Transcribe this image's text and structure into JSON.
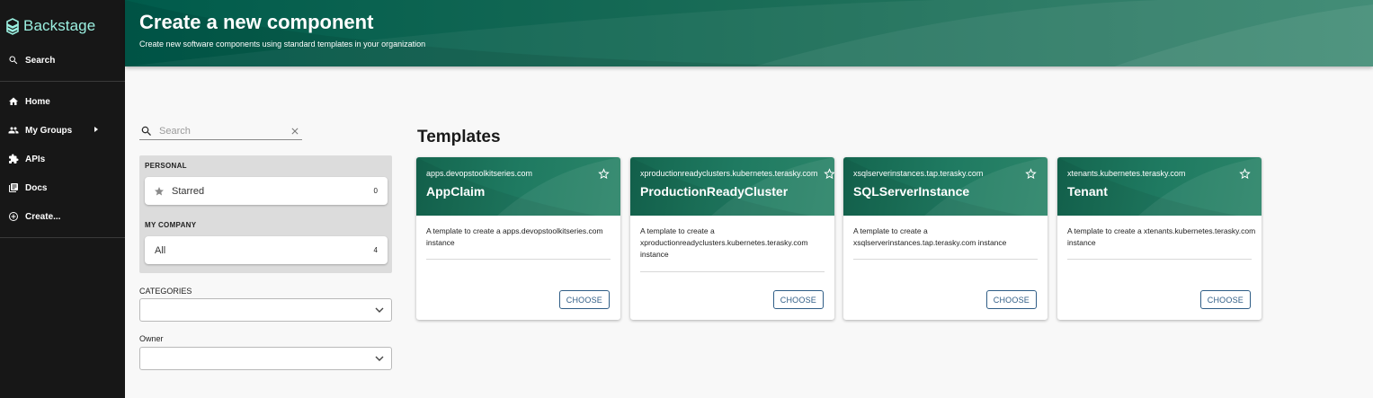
{
  "sidebar": {
    "logo_text": "Backstage",
    "search_label": "Search",
    "items": [
      {
        "label": "Home",
        "icon": "home-icon"
      },
      {
        "label": "My Groups",
        "icon": "people-icon"
      },
      {
        "label": "APIs",
        "icon": "puzzle-icon"
      },
      {
        "label": "Docs",
        "icon": "docs-icon"
      },
      {
        "label": "Create...",
        "icon": "add-circle-icon"
      }
    ]
  },
  "header": {
    "title": "Create a new component",
    "subtitle": "Create new software components using standard templates in your organization"
  },
  "filters": {
    "search_placeholder": "Search",
    "personal_heading": "PERSONAL",
    "starred_label": "Starred",
    "starred_count": "0",
    "company_heading": "MY COMPANY",
    "all_label": "All",
    "all_count": "4",
    "categories_label": "CATEGORIES",
    "categories_value": "",
    "owner_label": "Owner",
    "owner_value": ""
  },
  "templates": {
    "heading": "Templates",
    "cards": [
      {
        "type": "apps.devopstoolkitseries.com",
        "name": "AppClaim",
        "description": "A template to create a apps.devopstoolkitseries.com instance",
        "button": "CHOOSE"
      },
      {
        "type": "xproductionreadyclusters.kubernetes.terasky.com",
        "name": "ProductionReadyCluster",
        "description": "A template to create a xproductionreadyclusters.kubernetes.terasky.com instance",
        "button": "CHOOSE"
      },
      {
        "type": "xsqlserverinstances.tap.terasky.com",
        "name": "SQLServerInstance",
        "description": "A template to create a xsqlserverinstances.tap.terasky.com instance",
        "button": "CHOOSE"
      },
      {
        "type": "xtenants.kubernetes.terasky.com",
        "name": "Tenant",
        "description": "A template to create a xtenants.kubernetes.terasky.com instance",
        "button": "CHOOSE"
      }
    ]
  },
  "colors": {
    "sidebar_bg": "#171717",
    "logo_accent": "#9bf0e1",
    "header_green": "#005b4b",
    "button_blue": "#2f5d86"
  }
}
